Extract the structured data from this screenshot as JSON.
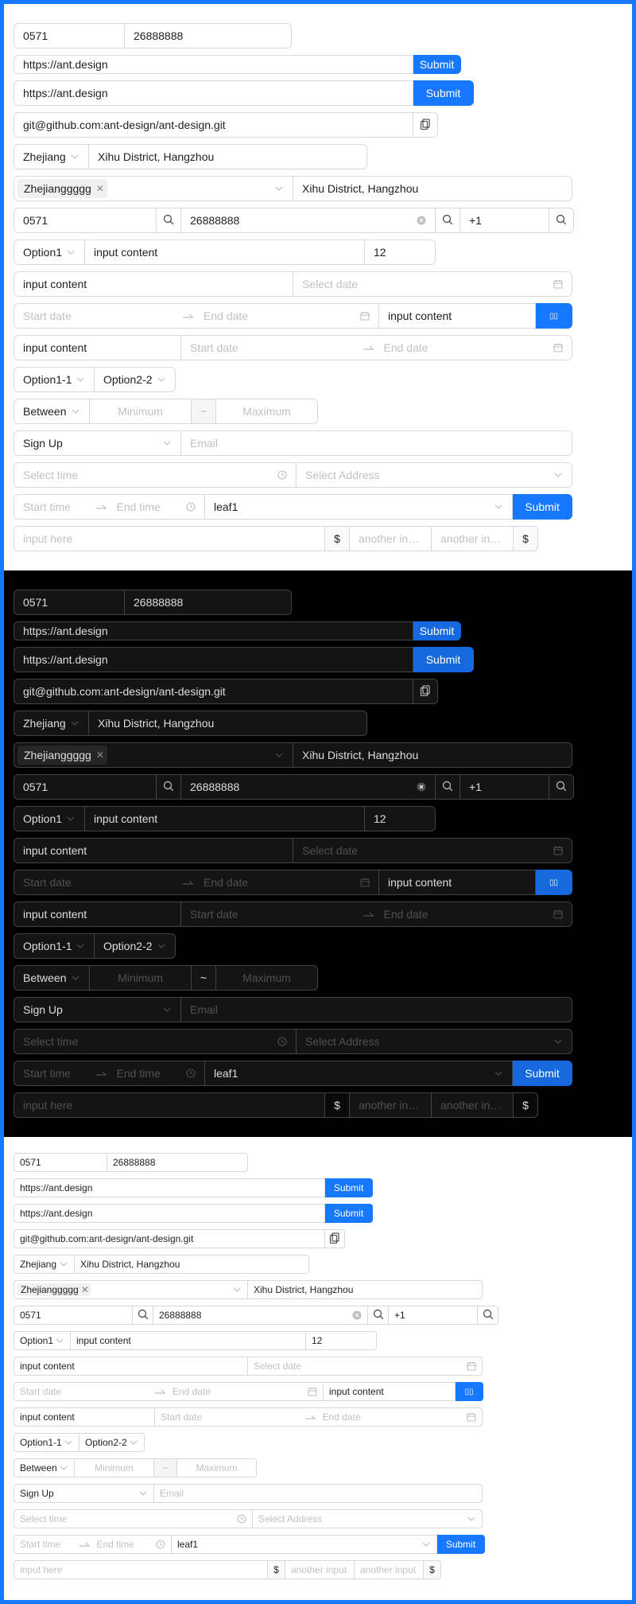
{
  "fields": {
    "area_code": "0571",
    "phone": "26888888",
    "url": "https://ant.design",
    "git_url": "git@github.com:ant-design/ant-design.git",
    "province": "Zhejiang",
    "address": "Xihu District, Hangzhou",
    "province_tag": "Zhejianggggg",
    "country_code": "+1",
    "option1": "Option1",
    "input_content": "input content",
    "number": "12",
    "option1_1": "Option1-1",
    "option2_2": "Option2-2",
    "between": "Between",
    "sign_up": "Sign Up",
    "leaf": "leaf1",
    "currency": "$"
  },
  "placeholders": {
    "select_date": "Select date",
    "start_date": "Start date",
    "end_date": "End date",
    "minimum": "Minimum",
    "maximum": "Maximum",
    "tilde": "~",
    "email": "Email",
    "select_time": "Select time",
    "select_address": "Select Address",
    "start_time": "Start time",
    "end_time": "End time",
    "input_here": "input here",
    "another_input": "another input"
  },
  "buttons": {
    "submit": "Submit",
    "glyph": "▯▯"
  },
  "colors": {
    "primary": "#1677ff",
    "dark_primary": "#1668dc",
    "dark_background": "#000000"
  },
  "icons": [
    "copy-icon",
    "search-icon",
    "clear-icon",
    "chevron-down-icon",
    "calendar-icon",
    "clock-icon",
    "swap-right-icon",
    "close-icon"
  ]
}
